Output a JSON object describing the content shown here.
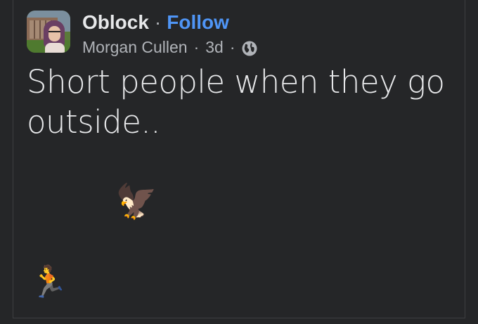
{
  "post": {
    "group_name": "Oblock",
    "separator": "·",
    "follow_label": "Follow",
    "author_name": "Morgan Cullen",
    "time_ago": "3d",
    "meta_separator": "·",
    "privacy_icon": "globe-icon",
    "text": "Short people when they go outside..",
    "emoji_eagle": "🦅",
    "emoji_runner": "🏃"
  },
  "colors": {
    "background": "#252628",
    "primary_text": "#e7e8ea",
    "secondary_text": "#b0b3b8",
    "link_blue": "#4f95f6"
  }
}
